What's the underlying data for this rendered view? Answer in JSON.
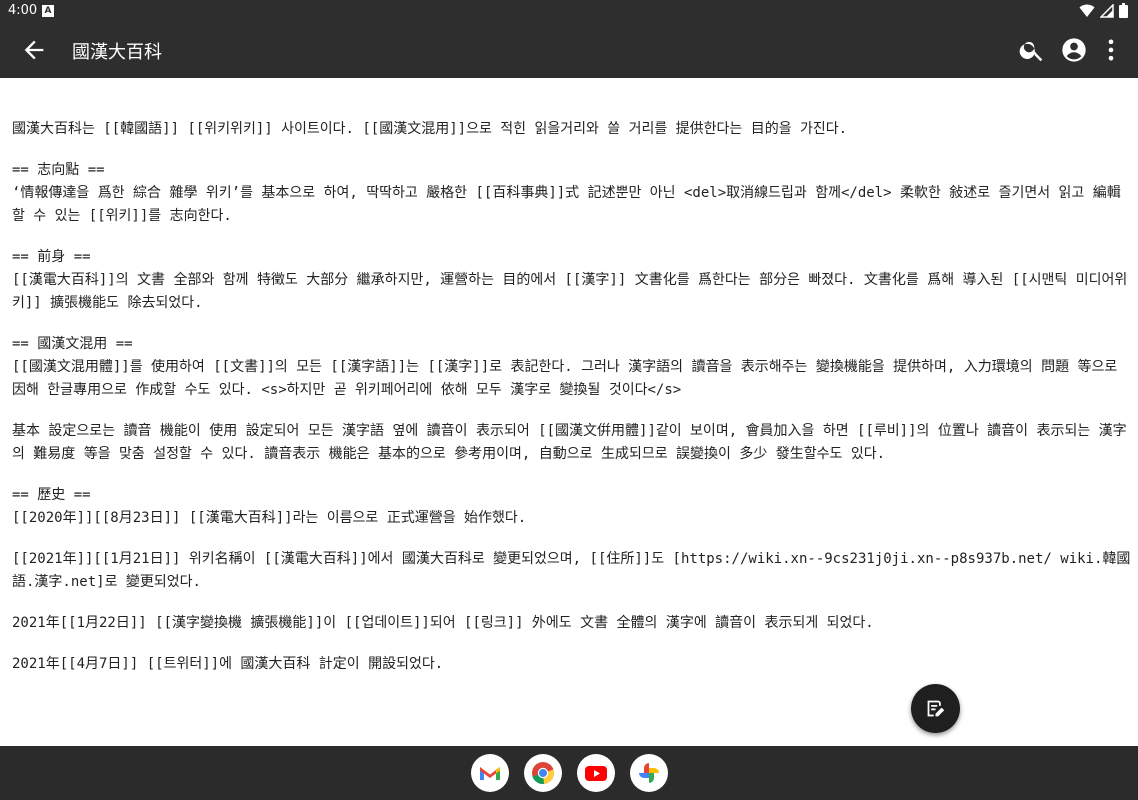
{
  "status_bar": {
    "time": "4:00",
    "notification_glyph": "A",
    "icons": [
      "wifi-icon",
      "signal-icon",
      "battery-icon"
    ]
  },
  "app_bar": {
    "title": "國漢大百科",
    "actions": [
      "search-icon",
      "account-icon",
      "more-vert-icon"
    ]
  },
  "article": {
    "paragraphs": [
      "國漢大百科는 [[韓國語]] [[위키위키]] 사이트이다. [[國漢文混用]]으로 적힌 읽을거리와 쓸 거리를 提供한다는 目的을 가진다.",
      "== 志向點 ==\n‘情報傳達을 爲한 綜合 雜學 위키’를 基本으로 하여, 딱딱하고 嚴格한 [[百科事典]]式 記述뿐만 아닌 <del>取消線드립과 함께</del> 柔軟한 敍述로 즐기면서 읽고 編輯할 수 있는 [[위키]]를 志向한다.",
      "== 前身 ==\n[[漢電大百科]]의 文書 全部와 함께 特徵도 大部分 繼承하지만, 運營하는 目的에서 [[漢字]] 文書化를 爲한다는 部分은 빠졌다. 文書化를 爲해 導入된 [[시맨틱 미디어위키]] 擴張機能도 除去되었다.",
      "== 國漢文混用 ==\n[[國漢文混用體]]를 使用하여 [[文書]]의 모든 [[漢字語]]는 [[漢字]]로 表記한다. 그러나 漢字語의 讀音을 表示해주는 變換機能을 提供하며, 入力環境의 問題 等으로 因해 한글專用으로 作成할 수도 있다. <s>하지만 곧 위키페어리에 依해 모두 漢字로 變換될 것이다</s>",
      "基本 設定으로는 讀音 機能이 使用 設定되어 모든 漢字語 옆에 讀音이 表示되어 [[國漢文倂用體]]같이 보이며, 會員加入을 하면 [[루비]]의 位置나 讀音이 表示되는 漢字의 難易度 等을 맞춤 설정할 수 있다. 讀音表示 機能은 基本的으로 參考用이며, 自動으로 生成되므로 誤變換이 多少 發生할수도 있다.",
      "== 歷史 ==\n[[2020年]][[8月23日]] [[漢電大百科]]라는 이름으로 正式運營을 始作했다.",
      "[[2021年]][[1月21日]] 위키名稱이 [[漢電大百科]]에서 國漢大百科로 變更되었으며, [[住所]]도 [https://wiki.xn--9cs231j0ji.xn--p8s937b.net/ wiki.韓國語.漢字.net]로 變更되었다.",
      "2021年[[1月22日]] [[漢字變換機 擴張機能]]이 [[업데이트]]되어 [[링크]] 外에도 文書 全體의 漢字에 讀音이 表示되게 되었다.",
      "2021年[[4月7日]] [[트위터]]에 國漢大百科 計定이 開設되었다."
    ]
  },
  "fab": {
    "icon": "edit-note-icon"
  },
  "dock": {
    "apps": [
      "gmail-icon",
      "chrome-icon",
      "youtube-icon",
      "photos-icon"
    ]
  },
  "colors": {
    "bar": "#2e2e2e",
    "nav": "#2b2b2b",
    "text": "#222222"
  }
}
